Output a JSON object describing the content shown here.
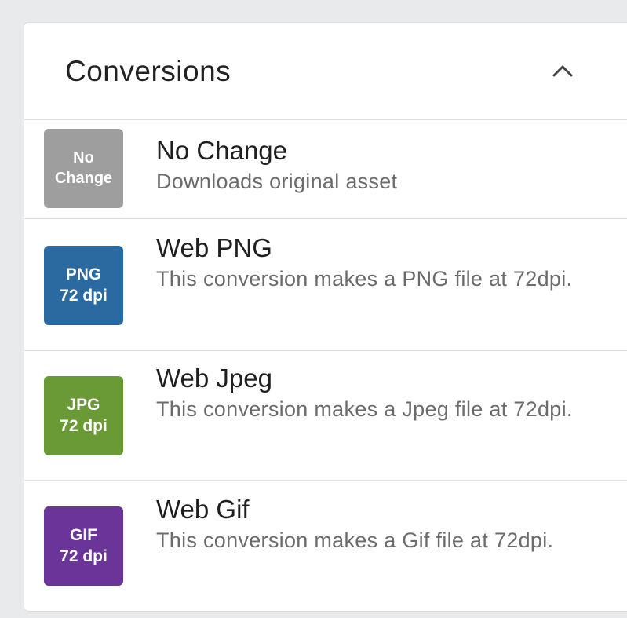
{
  "panel": {
    "title": "Conversions",
    "collapse_icon": "chevron-up-icon"
  },
  "conversions": [
    {
      "badge_line1": "No",
      "badge_line2": "Change",
      "badge_color": "#9e9e9e",
      "title": "No Change",
      "description": "Downloads original asset"
    },
    {
      "badge_line1": "PNG",
      "badge_line2": "72 dpi",
      "badge_color": "#2a6aa0",
      "title": "Web PNG",
      "description": "This conversion makes a PNG file at 72dpi."
    },
    {
      "badge_line1": "JPG",
      "badge_line2": "72 dpi",
      "badge_color": "#6a9a36",
      "title": "Web Jpeg",
      "description": "This conversion makes a Jpeg file at 72dpi."
    },
    {
      "badge_line1": "GIF",
      "badge_line2": "72 dpi",
      "badge_color": "#6a3498",
      "title": "Web Gif",
      "description": "This conversion makes a Gif file at 72dpi."
    }
  ]
}
